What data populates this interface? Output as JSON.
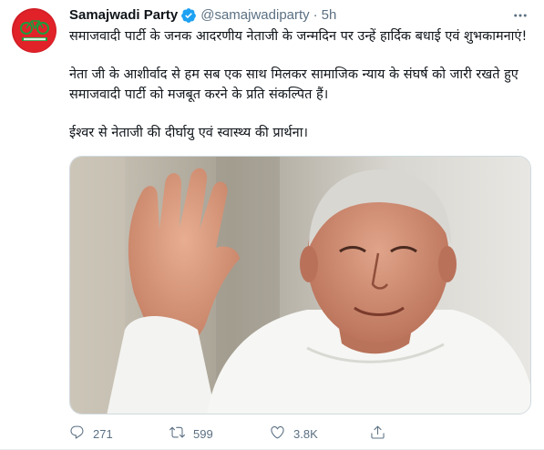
{
  "tweet": {
    "author_name": "Samajwadi Party",
    "handle": "@samajwadiparty",
    "separator": "·",
    "time": "5h",
    "paragraphs": [
      "समाजवादी पार्टी के जनक आदरणीय नेताजी के जन्मदिन पर उन्हें हार्दिक बधाई एवं शुभकामनाएं!",
      "नेता जी के आशीर्वाद से हम सब एक साथ मिलकर सामाजिक न्याय के संघर्ष को जारी रखते हुए समाजवादी पार्टी को मजबूत करने के प्रति संकल्पित हैं।",
      "ईश्वर से नेताजी की दीर्घायु एवं स्वास्थ्य की प्रार्थना।"
    ],
    "avatar_text": "समाजवादी पार्टी",
    "replies": "271",
    "retweets": "599",
    "likes": "3.8K"
  },
  "colors": {
    "brand_red": "#d21f26",
    "verified_blue": "#1da1f2",
    "muted": "#5b7083"
  },
  "icons": [
    "verified-badge-icon",
    "more-options-icon",
    "reply-icon",
    "retweet-icon",
    "like-icon",
    "share-icon"
  ]
}
